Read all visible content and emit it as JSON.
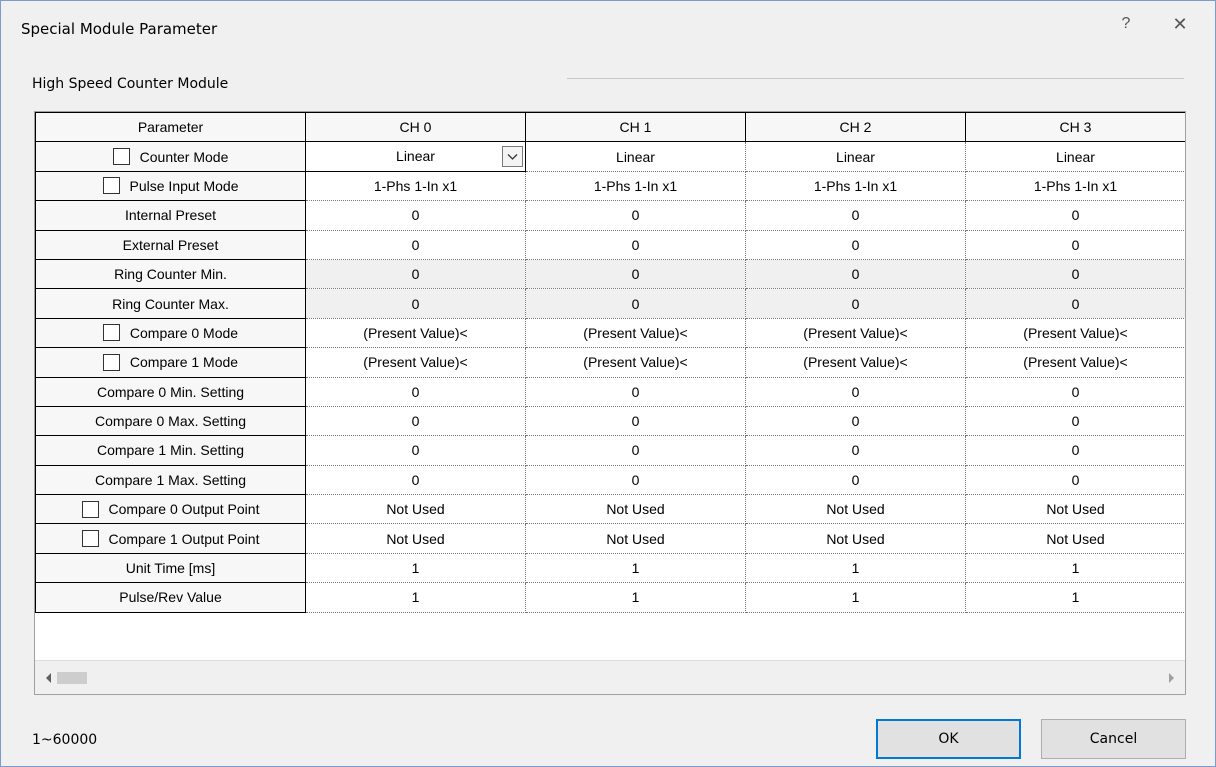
{
  "window": {
    "title": "Special Module Parameter",
    "help_glyph": "?",
    "close_glyph": "✕"
  },
  "group": {
    "label": "High Speed Counter Module"
  },
  "grid": {
    "header": [
      "Parameter",
      "CH 0",
      "CH 1",
      "CH 2",
      "CH 3"
    ],
    "rows": [
      {
        "label": "Counter Mode",
        "checkbox": true,
        "checked": false,
        "values": [
          "Linear",
          "Linear",
          "Linear",
          "Linear"
        ],
        "shaded": false
      },
      {
        "label": "Pulse Input Mode",
        "checkbox": true,
        "checked": false,
        "values": [
          "1-Phs 1-In x1",
          "1-Phs 1-In x1",
          "1-Phs 1-In x1",
          "1-Phs 1-In x1"
        ],
        "shaded": false
      },
      {
        "label": "Internal Preset",
        "checkbox": false,
        "values": [
          "0",
          "0",
          "0",
          "0"
        ],
        "shaded": false
      },
      {
        "label": "External Preset",
        "checkbox": false,
        "values": [
          "0",
          "0",
          "0",
          "0"
        ],
        "shaded": false
      },
      {
        "label": "Ring Counter Min.",
        "checkbox": false,
        "values": [
          "0",
          "0",
          "0",
          "0"
        ],
        "shaded": true
      },
      {
        "label": "Ring Counter Max.",
        "checkbox": false,
        "values": [
          "0",
          "0",
          "0",
          "0"
        ],
        "shaded": true
      },
      {
        "label": "Compare 0 Mode",
        "checkbox": true,
        "checked": false,
        "values": [
          "(Present Value)<",
          "(Present Value)<",
          "(Present Value)<",
          "(Present Value)<"
        ],
        "shaded": false
      },
      {
        "label": "Compare 1 Mode",
        "checkbox": true,
        "checked": false,
        "values": [
          "(Present Value)<",
          "(Present Value)<",
          "(Present Value)<",
          "(Present Value)<"
        ],
        "shaded": false
      },
      {
        "label": "Compare 0 Min. Setting",
        "checkbox": false,
        "values": [
          "0",
          "0",
          "0",
          "0"
        ],
        "shaded": false
      },
      {
        "label": "Compare 0 Max. Setting",
        "checkbox": false,
        "values": [
          "0",
          "0",
          "0",
          "0"
        ],
        "shaded": false
      },
      {
        "label": "Compare 1 Min. Setting",
        "checkbox": false,
        "values": [
          "0",
          "0",
          "0",
          "0"
        ],
        "shaded": false
      },
      {
        "label": "Compare 1 Max. Setting",
        "checkbox": false,
        "values": [
          "0",
          "0",
          "0",
          "0"
        ],
        "shaded": false
      },
      {
        "label": "Compare 0 Output Point",
        "checkbox": true,
        "checked": false,
        "values": [
          "Not Used",
          "Not Used",
          "Not Used",
          "Not Used"
        ],
        "shaded": false
      },
      {
        "label": "Compare 1 Output Point",
        "checkbox": true,
        "checked": false,
        "values": [
          "Not Used",
          "Not Used",
          "Not Used",
          "Not Used"
        ],
        "shaded": false
      },
      {
        "label": "Unit Time [ms]",
        "checkbox": false,
        "values": [
          "1",
          "1",
          "1",
          "1"
        ],
        "shaded": false
      },
      {
        "label": "Pulse/Rev Value",
        "checkbox": false,
        "values": [
          "1",
          "1",
          "1",
          "1"
        ],
        "shaded": false
      }
    ],
    "selected": {
      "row": 0,
      "col": 0
    }
  },
  "footer": {
    "range_hint": "1~60000",
    "ok_label": "OK",
    "cancel_label": "Cancel"
  },
  "colors": {
    "window_bg": "#f0f0f0",
    "ok_focus_border": "#0078d7",
    "shaded_row_bg": "#f0f0f0"
  }
}
